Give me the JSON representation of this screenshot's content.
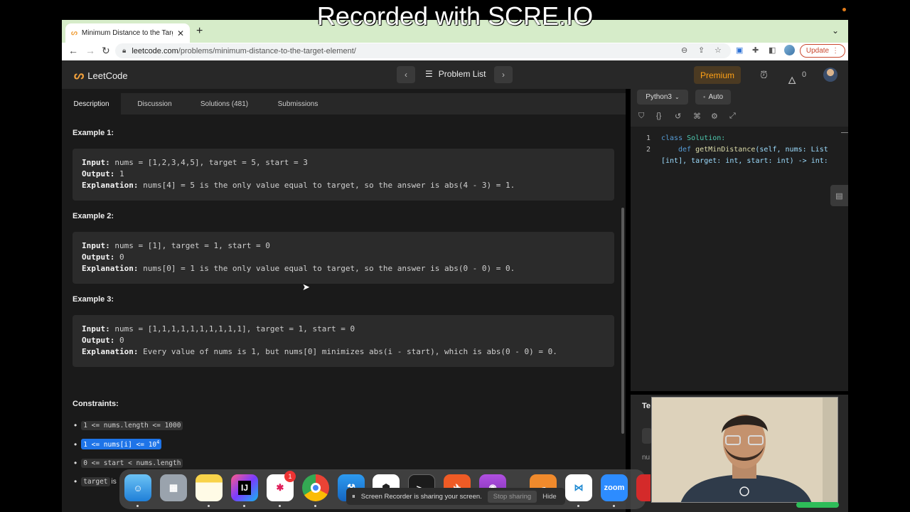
{
  "recording_banner": "Recorded with SCRE.IO",
  "browser": {
    "tab_title": "Minimum Distance to the Target",
    "tab_close": "✕",
    "new_tab": "+",
    "url_domain": "leetcode.com",
    "url_path": "/problems/minimum-distance-to-the-target-element/",
    "update_label": "Update"
  },
  "leetcode_nav": {
    "logo_text": "LeetCode",
    "problem_list": "Problem List",
    "premium": "Premium",
    "streak_count": "0"
  },
  "description_tabs": [
    {
      "label": "Description"
    },
    {
      "label": "Discussion"
    },
    {
      "label": "Solutions (481)"
    },
    {
      "label": "Submissions"
    }
  ],
  "examples": [
    {
      "heading": "Example 1:",
      "input_label": "Input:",
      "input": " nums = [1,2,3,4,5], target = 5, start = 3",
      "output_label": "Output:",
      "output": " 1",
      "explanation_label": "Explanation:",
      "explanation": " nums[4] = 5 is the only value equal to target, so the answer is abs(4 - 3) = 1."
    },
    {
      "heading": "Example 2:",
      "input_label": "Input:",
      "input": " nums = [1], target = 1, start = 0",
      "output_label": "Output:",
      "output": " 0",
      "explanation_label": "Explanation:",
      "explanation": " nums[0] = 1 is the only value equal to target, so the answer is abs(0 - 0) = 0."
    },
    {
      "heading": "Example 3:",
      "input_label": "Input:",
      "input": " nums = [1,1,1,1,1,1,1,1,1,1], target = 1, start = 0",
      "output_label": "Output:",
      "output": " 0",
      "explanation_label": "Explanation:",
      "explanation": " Every value of nums is 1, but nums[0] minimizes abs(i - start), which is abs(0 - 0) = 0."
    }
  ],
  "constraints": {
    "heading": "Constraints:",
    "items": [
      {
        "code": "1 <= nums.length <= 1000"
      },
      {
        "code": "1 <= nums[i] <= 10",
        "sup": "4"
      },
      {
        "code": "0 <= start < nums.length"
      },
      {
        "code": "target",
        "suffix": " is"
      }
    ]
  },
  "editor": {
    "language": "Python3",
    "mode": "Auto",
    "line_numbers": [
      "1",
      "2"
    ],
    "code": {
      "l1_kw": "class",
      "l1_name": " Solution:",
      "l2_kw": "def",
      "l2_fn": "getMinDistance",
      "l2_rest": "(self, nums: List",
      "l3": "[int], target: int, start: int) -> int:"
    }
  },
  "console": {
    "tab": "Te",
    "partial": "nu"
  },
  "dock": {
    "badge": "1",
    "apps": [
      "Finder",
      "Launchpad",
      "Notes",
      "IntelliJ",
      "Slack",
      "Chrome",
      "Xcode",
      "GitHub",
      "Terminal",
      "Postman",
      "Podcasts",
      "Cloud",
      "VS Code",
      "Zoom",
      "Acrobat"
    ],
    "zoom_label": "zoom",
    "ij_label": "IJ"
  },
  "share_bar": {
    "message": "Screen Recorder is sharing your screen.",
    "stop": "Stop sharing",
    "hide": "Hide"
  },
  "colors": {
    "accent_orange": "#ffa116",
    "selection_blue": "#1e74e8",
    "panel_bg": "#1a1a1a",
    "code_box_bg": "#2b2b2b"
  }
}
